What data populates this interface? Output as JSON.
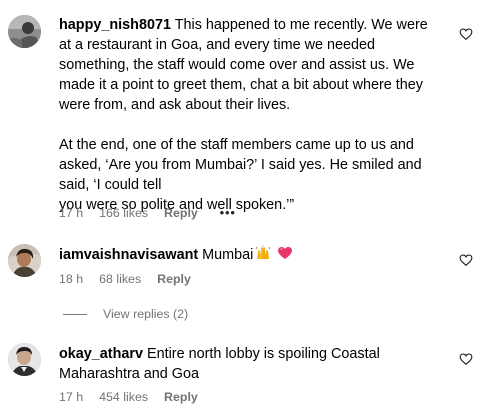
{
  "comments": [
    {
      "username": "happy_nish8071",
      "text": " This happened to me recently. We were at a restaurant in Goa, and every time we needed something, the staff would come over and assist us. We made it a point to greet them, chat a bit about where they were from, and ask about their lives.\n\nAt the end, one of the staff members came up to us and asked, ‘Are you from Mumbai?’ I said yes. He smiled and said, ‘I could tell\nyou were so polite and well spoken.’”",
      "time": "17 h",
      "likes": "166 likes",
      "reply": "Reply",
      "more": "•••"
    },
    {
      "username": "iamvaishnavisawant",
      "text": " Mumbai",
      "emojis": [
        "raising-hands-emoji",
        "pink-heart-emoji"
      ],
      "time": "18 h",
      "likes": "68 likes",
      "reply": "Reply",
      "view_replies": "View replies (2)"
    },
    {
      "username": "okay_atharv",
      "text": " Entire north lobby is spoiling Coastal Maharashtra and Goa",
      "time": "17 h",
      "likes": "454 likes",
      "reply": "Reply"
    }
  ],
  "icons": {
    "like": "heart-outline-icon"
  },
  "colors": {
    "text": "#000000",
    "meta": "#737373",
    "emoji_heart": "#e8356b",
    "emoji_hands": "#f5b81c"
  }
}
